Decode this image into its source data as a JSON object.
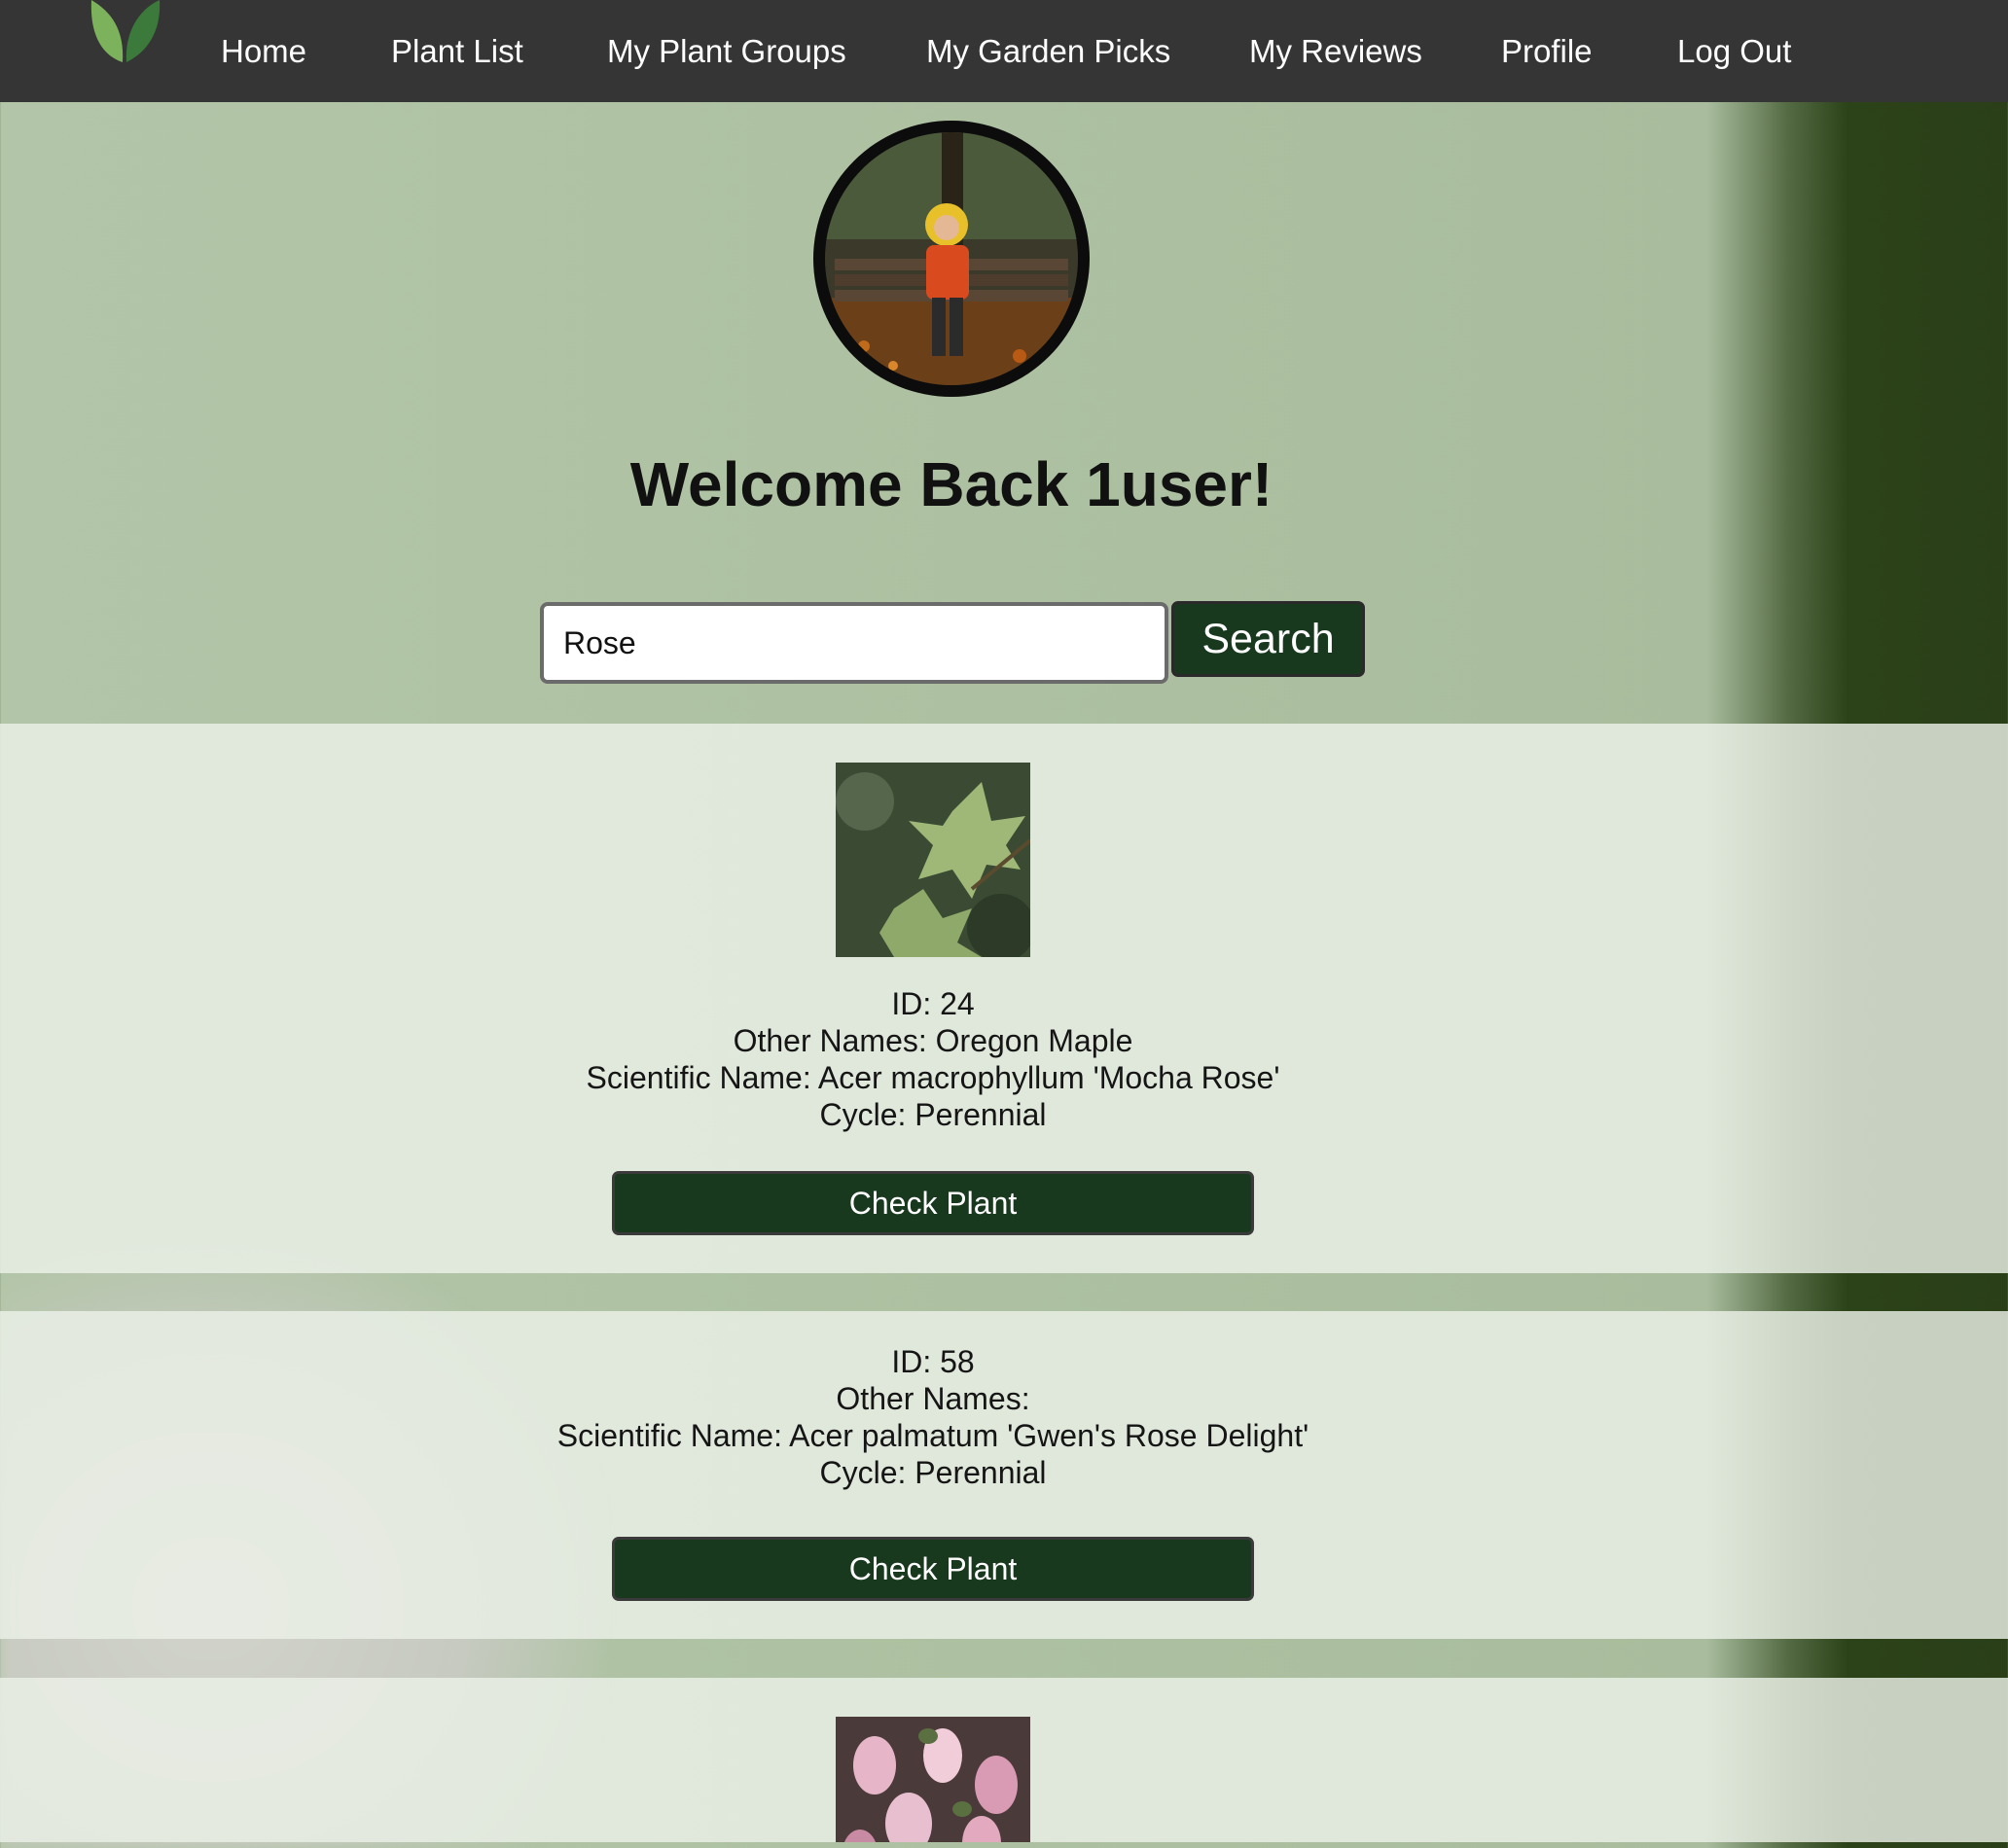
{
  "nav": {
    "items": [
      {
        "label": "Home"
      },
      {
        "label": "Plant List"
      },
      {
        "label": "My Plant Groups"
      },
      {
        "label": "My Garden Picks"
      },
      {
        "label": "My Reviews"
      },
      {
        "label": "Profile"
      },
      {
        "label": "Log Out"
      }
    ]
  },
  "header": {
    "welcome": "Welcome Back 1user!"
  },
  "search": {
    "value": "Rose",
    "button_label": "Search"
  },
  "results": [
    {
      "id_line": "ID: 24",
      "other_names_line": "Other Names: Oregon Maple",
      "scientific_line": "Scientific Name: Acer macrophyllum 'Mocha Rose'",
      "cycle_line": "Cycle: Perennial",
      "button_label": "Check Plant"
    },
    {
      "id_line": "ID: 58",
      "other_names_line": "Other Names:",
      "scientific_line": "Scientific Name: Acer palmatum 'Gwen's Rose Delight'",
      "cycle_line": "Cycle: Perennial",
      "button_label": "Check Plant"
    }
  ],
  "colors": {
    "navbar": "#353535",
    "button": "#18391e",
    "card_overlay": "#ecf0e8"
  }
}
